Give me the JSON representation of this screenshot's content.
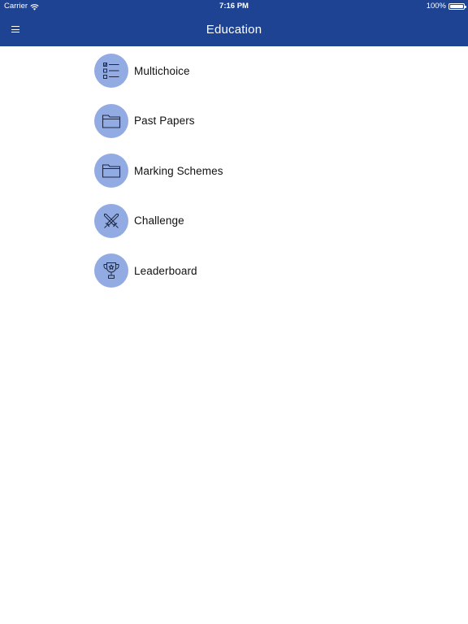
{
  "status_bar": {
    "carrier": "Carrier",
    "time": "7:16 PM",
    "battery": "100%"
  },
  "nav": {
    "title": "Education",
    "menu_icon": "hamburger-menu-icon"
  },
  "colors": {
    "header_bg": "#1e4392",
    "icon_circle_bg": "#93abe3",
    "icon_stroke": "#1e2a44"
  },
  "menu": {
    "items": [
      {
        "label": "Multichoice",
        "icon": "checklist-icon"
      },
      {
        "label": "Past Papers",
        "icon": "folder-icon"
      },
      {
        "label": "Marking Schemes",
        "icon": "folder-icon"
      },
      {
        "label": "Challenge",
        "icon": "crossed-swords-icon"
      },
      {
        "label": "Leaderboard",
        "icon": "trophy-icon"
      }
    ]
  }
}
